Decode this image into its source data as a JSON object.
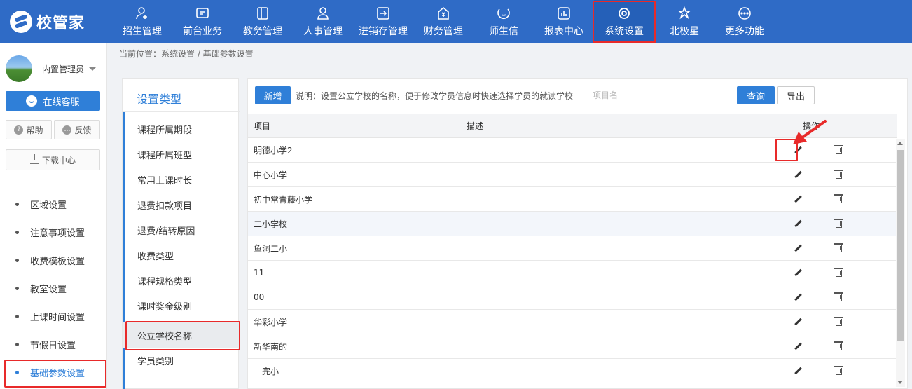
{
  "brand": {
    "name": "校管家"
  },
  "nav": [
    {
      "label": "招生管理",
      "icon": "person-add-icon"
    },
    {
      "label": "前台业务",
      "icon": "chat-window-icon"
    },
    {
      "label": "教务管理",
      "icon": "book-icon"
    },
    {
      "label": "人事管理",
      "icon": "person-icon"
    },
    {
      "label": "进销存管理",
      "icon": "inventory-icon"
    },
    {
      "label": "财务管理",
      "icon": "money-house-icon"
    },
    {
      "label": "师生信",
      "icon": "message-icon"
    },
    {
      "label": "报表中心",
      "icon": "report-icon"
    },
    {
      "label": "系统设置",
      "icon": "settings-icon",
      "active": true
    },
    {
      "label": "北极星",
      "icon": "star-icon"
    },
    {
      "label": "更多功能",
      "icon": "more-icon"
    }
  ],
  "user": {
    "name": "内置管理员"
  },
  "sidebar": {
    "online_service": "在线客服",
    "help": "帮助",
    "feedback": "反馈",
    "download": "下载中心",
    "menu": [
      {
        "label": "区域设置"
      },
      {
        "label": "注意事项设置"
      },
      {
        "label": "收费模板设置"
      },
      {
        "label": "教室设置"
      },
      {
        "label": "上课时间设置"
      },
      {
        "label": "节假日设置"
      },
      {
        "label": "基础参数设置",
        "active": true
      }
    ]
  },
  "breadcrumb": {
    "text": "当前位置：系统设置 / 基础参数设置"
  },
  "types": {
    "title": "设置类型",
    "items": [
      {
        "label": "课程所属期段"
      },
      {
        "label": "课程所属班型"
      },
      {
        "label": "常用上课时长"
      },
      {
        "label": "退费扣款项目"
      },
      {
        "label": "退费/结转原因"
      },
      {
        "label": "收费类型"
      },
      {
        "label": "课程规格类型"
      },
      {
        "label": "课时奖金级别"
      },
      {
        "label": "公立学校名称",
        "active": true
      },
      {
        "label": "学员类别"
      }
    ]
  },
  "toolbar": {
    "add_label": "新增",
    "hint": "说明：设置公立学校的名称，便于修改学员信息时快速选择学员的就读学校",
    "search_placeholder": "项目名",
    "query_label": "查询",
    "export_label": "导出"
  },
  "table": {
    "columns": {
      "item": "项目",
      "desc": "描述",
      "op": "操作"
    },
    "rows": [
      {
        "item": "明德小学2",
        "desc": ""
      },
      {
        "item": "中心小学",
        "desc": ""
      },
      {
        "item": "初中常青藤小学",
        "desc": ""
      },
      {
        "item": "二小学校",
        "desc": "",
        "highlight": true
      },
      {
        "item": "鱼洞二小",
        "desc": ""
      },
      {
        "item": "11",
        "desc": ""
      },
      {
        "item": "00",
        "desc": ""
      },
      {
        "item": "华彩小学",
        "desc": ""
      },
      {
        "item": "新华南的",
        "desc": ""
      },
      {
        "item": "一完小",
        "desc": ""
      }
    ]
  },
  "colors": {
    "primary": "#2f6bc6",
    "accent": "#2f7fd8",
    "highlight": "#e82a2a"
  }
}
